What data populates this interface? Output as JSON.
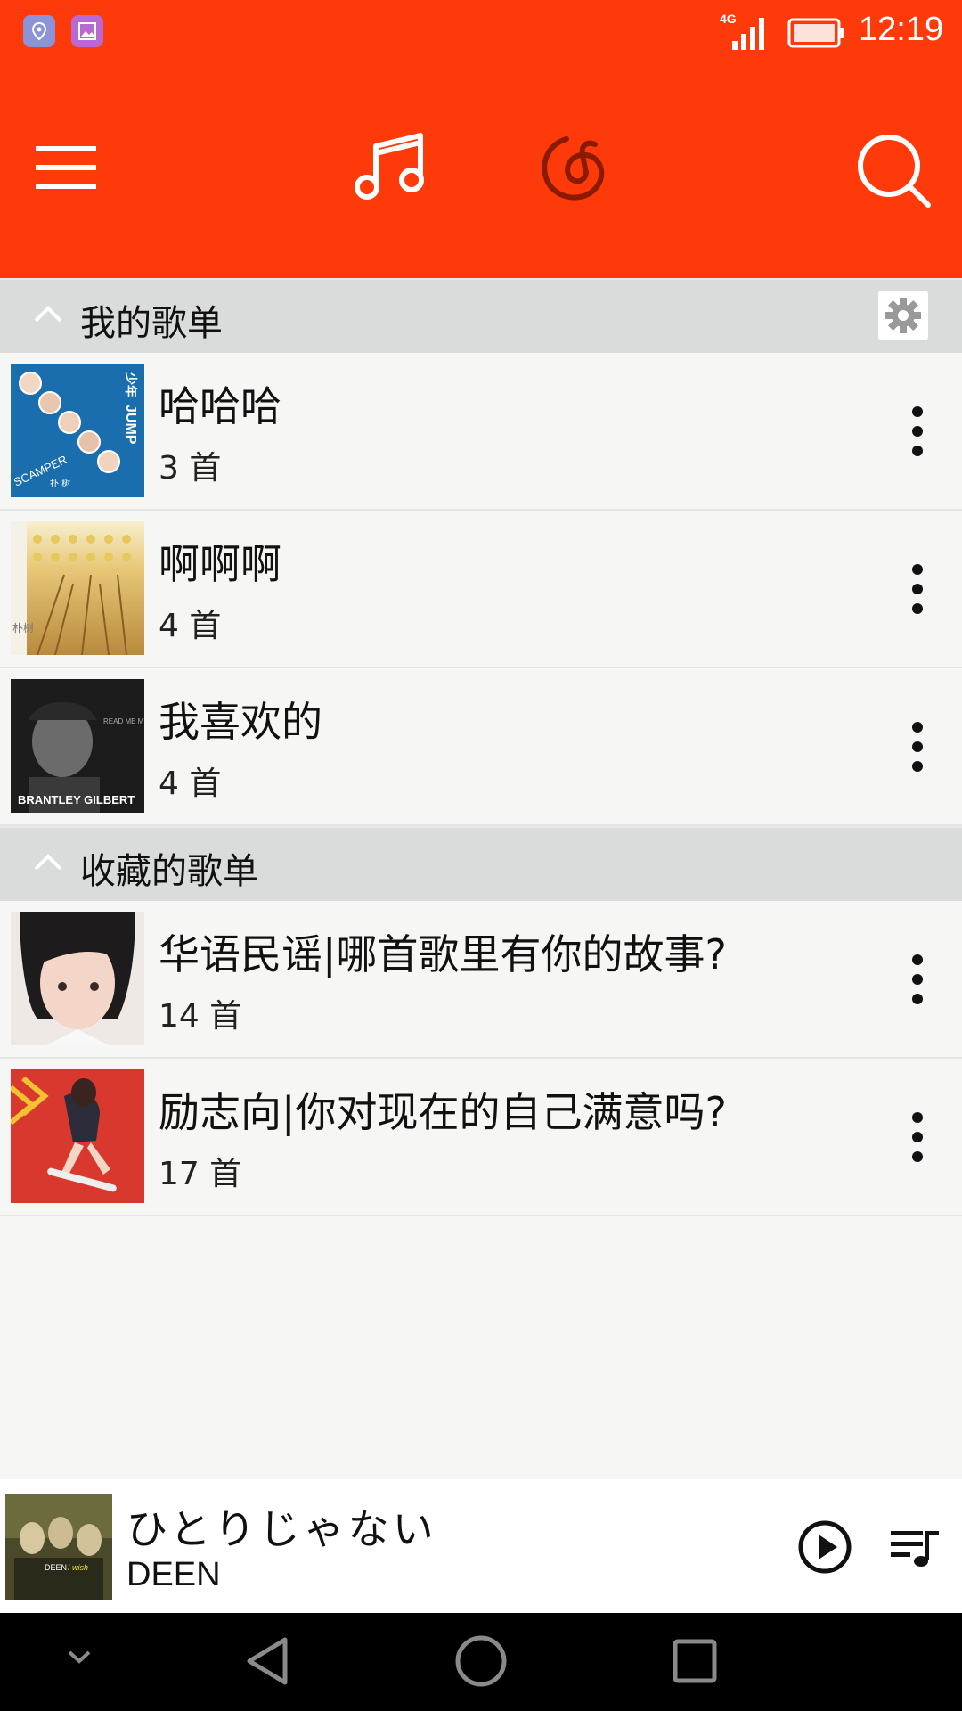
{
  "status_bar": {
    "time": "12:19",
    "network": "4G",
    "colors": {
      "app_bar": "#ff3a0a"
    }
  },
  "header": {
    "icons": [
      "menu-icon",
      "music-note-icon",
      "netease-logo-icon",
      "search-icon"
    ]
  },
  "sections": [
    {
      "title": "我的歌单",
      "has_settings": true,
      "playlists": [
        {
          "name": "哈哈哈",
          "count": "3 首"
        },
        {
          "name": "啊啊啊",
          "count": "4 首"
        },
        {
          "name": "我喜欢的",
          "count": "4 首"
        }
      ]
    },
    {
      "title": "收藏的歌单",
      "has_settings": false,
      "playlists": [
        {
          "name": "华语民谣|哪首歌里有你的故事?",
          "count": "14 首"
        },
        {
          "name": "励志向|你对现在的自己满意吗?",
          "count": "17 首"
        }
      ]
    }
  ],
  "cover_art_text": {
    "cover1": {
      "title": "JUMP",
      "subtitle": "少年",
      "caption": "SCAMPER",
      "sub_caption": "扑 树"
    },
    "cover2": {
      "caption": "朴树"
    },
    "cover3": {
      "caption": "BRANTLEY GILBERT",
      "title": "READ ME MY RIGHTS"
    },
    "player_art": {
      "caption": "DEEN",
      "sub_caption": "I wish"
    }
  },
  "player": {
    "song": "ひとりじゃない",
    "artist": "DEEN"
  },
  "navbar": {
    "icons": [
      "collapse-icon",
      "back-icon",
      "home-icon",
      "recents-icon"
    ]
  }
}
